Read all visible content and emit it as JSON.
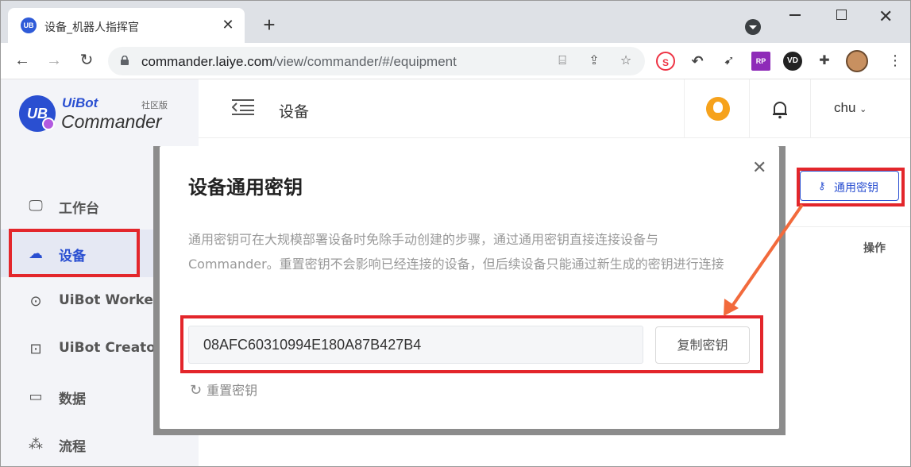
{
  "browser": {
    "tab_title": "设备_机器人指挥官",
    "favicon_text": "UB",
    "url_host": "commander.laiye.com",
    "url_path": "/view/commander/#/equipment"
  },
  "app": {
    "logo_uibot": "UiBot",
    "logo_commander": "Commander",
    "logo_edition": "社区版",
    "logo_badge": "UB",
    "page_title": "设备",
    "user_name": "chu",
    "sidebar": {
      "items": [
        {
          "label": "工作台",
          "icon": "monitor-icon"
        },
        {
          "label": "设备",
          "icon": "device-icon"
        },
        {
          "label": "UiBot Worker",
          "icon": "robot-icon"
        },
        {
          "label": "UiBot Creator",
          "icon": "terminal-icon"
        },
        {
          "label": "数据",
          "icon": "folder-icon"
        },
        {
          "label": "流程",
          "icon": "flow-icon"
        }
      ],
      "active_index": 1
    },
    "common_key_button": "通用密钥",
    "table_header_ops": "操作"
  },
  "modal": {
    "title": "设备通用密钥",
    "description": "通用密钥可在大规模部署设备时免除手动创建的步骤，通过通用密钥直接连接设备与Commander。重置密钥不会影响已经连接的设备，但后续设备只能通过新生成的密钥进行连接",
    "key_value": "08AFC60310994E180A87B427B4",
    "copy_button": "复制密钥",
    "reset_link": "重置密钥"
  },
  "annotation_color": "#e3262b",
  "arrow_color": "#f26a3c"
}
